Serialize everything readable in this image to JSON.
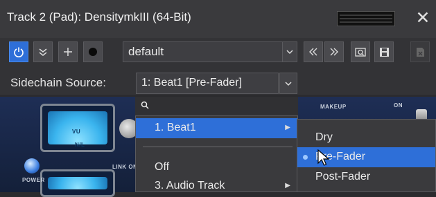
{
  "window": {
    "title": "Track 2 (Pad): DensitymkIII (64-Bit)",
    "close_glyph": "✕"
  },
  "toolbar": {
    "preset_name": "default",
    "icons": [
      "power-icon",
      "expand-icon",
      "add-icon",
      "record-icon",
      "dropdown-arrow-icon",
      "previous-preset-icon",
      "next-preset-icon",
      "browse-presets-icon",
      "save-preset-icon",
      "delete-preset-icon"
    ]
  },
  "sidechain": {
    "label": "Sidechain Source:",
    "selected": "1: Beat1 [Pre-Fader]"
  },
  "dropdown": {
    "search_placeholder": "",
    "items": [
      {
        "label": "1. Beat1",
        "has_submenu": true,
        "highlighted": true
      },
      {
        "label": "Off",
        "has_submenu": false,
        "highlighted": false
      },
      {
        "label": "3. Audio Track",
        "has_submenu": true,
        "highlighted": false
      }
    ]
  },
  "submenu": {
    "items": [
      {
        "label": "Dry",
        "selected": false
      },
      {
        "label": "Pre-Fader",
        "selected": true
      },
      {
        "label": "Post-Fader",
        "selected": false
      }
    ]
  },
  "plugin": {
    "labels": {
      "power": "POWER",
      "link": "LINK ON",
      "makeup": "MAKEUP",
      "on": "ON",
      "vu": "VU",
      "nl": "N/L"
    }
  },
  "colors": {
    "accent": "#2e6fd8",
    "vu_face": "#3ab4ee",
    "plugin_bg": "#1b2a4e"
  }
}
